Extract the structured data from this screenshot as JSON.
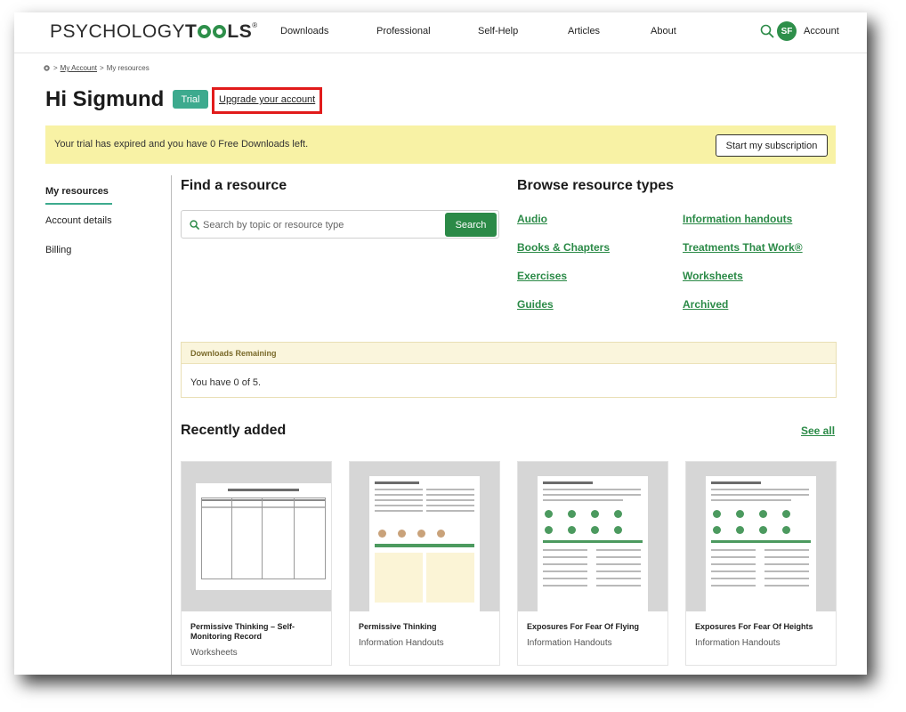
{
  "header": {
    "logo": {
      "part1": "PSYCHOLOGY",
      "part2a": "T",
      "part2b": "LS",
      "mark": "®"
    },
    "nav": [
      "Downloads",
      "Professional",
      "Self-Help",
      "Articles",
      "About"
    ],
    "avatar_initials": "SF",
    "account_label": "Account"
  },
  "breadcrumb": {
    "sep": ">",
    "account": "My Account",
    "current": "My resources"
  },
  "greeting": "Hi Sigmund",
  "badge": "Trial",
  "upgrade_link": "Upgrade your account",
  "alert": {
    "text": "Your trial has expired and you have 0 Free Downloads left.",
    "button": "Start my subscription"
  },
  "sidebar": {
    "items": [
      "My resources",
      "Account details",
      "Billing"
    ]
  },
  "find": {
    "title": "Find a resource",
    "placeholder": "Search by topic or resource type",
    "button": "Search"
  },
  "browse": {
    "title": "Browse resource types",
    "left": [
      "Audio",
      "Books & Chapters",
      "Exercises",
      "Guides"
    ],
    "right": [
      "Information handouts",
      "Treatments That Work®",
      "Worksheets",
      "Archived"
    ]
  },
  "downloads": {
    "title": "Downloads Remaining",
    "text": "You have 0 of 5."
  },
  "recent": {
    "title": "Recently added",
    "see_all": "See all",
    "cards": [
      {
        "title": "Permissive Thinking – Self-Monitoring Record",
        "type": "Worksheets"
      },
      {
        "title": "Permissive Thinking",
        "type": "Information Handouts"
      },
      {
        "title": "Exposures For Fear Of Flying",
        "type": "Information Handouts"
      },
      {
        "title": "Exposures For Fear Of Heights",
        "type": "Information Handouts"
      }
    ]
  },
  "colors": {
    "brand_green": "#2b8a47",
    "teal": "#3daa8e",
    "alert_yellow": "#f8f2a5",
    "highlight_red": "#e11b1b"
  }
}
